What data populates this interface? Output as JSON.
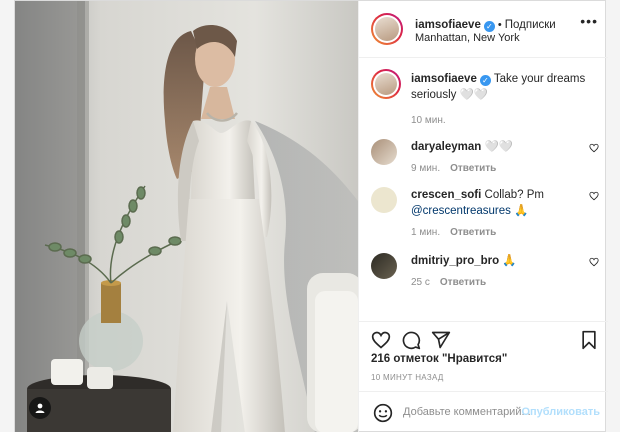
{
  "post": {
    "author": "iamsofiaeve",
    "follow_label": "Подписки",
    "location": "Manhattan, New York",
    "caption": "Take your dreams seriously 🤍🤍",
    "caption_time": "10 мин."
  },
  "comments": [
    {
      "user": "daryaleyman",
      "text": "🤍🤍",
      "time": "9 мин.",
      "reply": "Ответить"
    },
    {
      "user": "crescen_sofi",
      "text": "Collab? Pm",
      "mention": "@crescentreasures",
      "emoji": "🙏",
      "time": "1 мин.",
      "reply": "Ответить"
    },
    {
      "user": "dmitriy_pro_bro",
      "text": "🙏",
      "time": "25 с",
      "reply": "Ответить"
    }
  ],
  "stats": {
    "likes": "216 отметок \"Нравится\"",
    "ago": "10 МИНУТ НАЗАД"
  },
  "composer": {
    "placeholder": "Добавьте комментарий...",
    "publish": "Опубликовать"
  },
  "colors": {
    "link": "#00376b",
    "verified": "#3897f0",
    "muted": "#8e8e8e"
  },
  "icons": [
    "heart-icon",
    "comment-icon",
    "share-icon",
    "bookmark-icon",
    "emoji-icon",
    "user-tag-icon",
    "more-icon",
    "verified-badge"
  ]
}
